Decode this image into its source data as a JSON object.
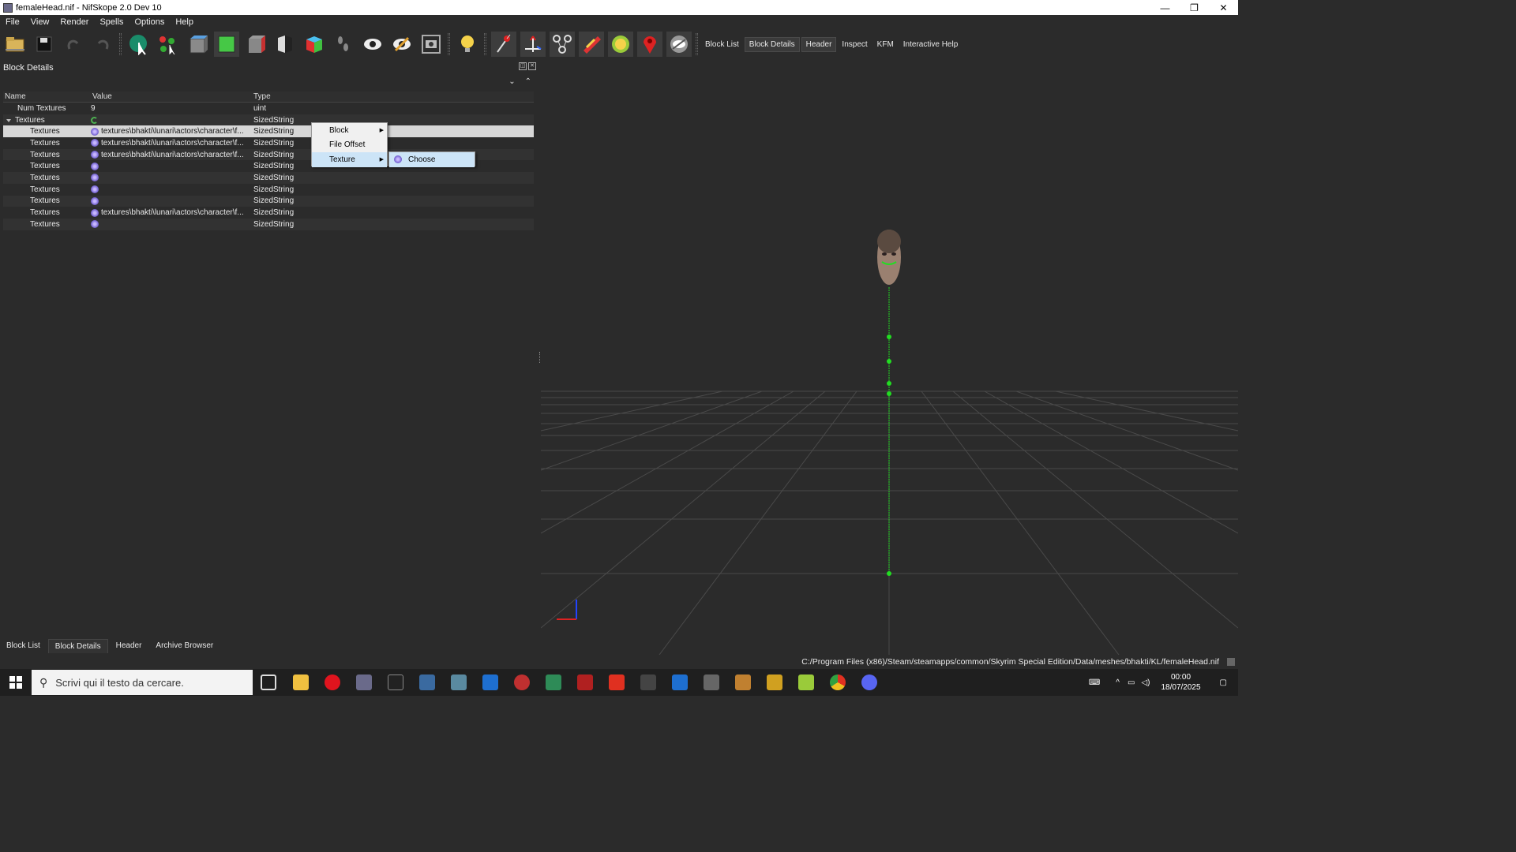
{
  "window": {
    "title": "femaleHead.nif - NifSkope 2.0 Dev 10",
    "buttons": [
      "—",
      "❐",
      "✕"
    ]
  },
  "menubar": {
    "items": [
      "File",
      "View",
      "Render",
      "Spells",
      "Options",
      "Help"
    ]
  },
  "toolbar": {
    "tabs": [
      "Block List",
      "Block Details",
      "Header",
      "Inspect",
      "KFM",
      "Interactive Help"
    ],
    "active_tab": "Block Details"
  },
  "block_details": {
    "title": "Block Details",
    "columns": {
      "name": "Name",
      "value": "Value",
      "type": "Type"
    },
    "rows": [
      {
        "name": "Num Textures",
        "value": "9",
        "type": "uint"
      },
      {
        "name": "Textures",
        "value": "",
        "type": "SizedString"
      },
      {
        "name": "Textures",
        "value": "textures\\bhakti\\lunari\\actors\\character\\f...",
        "type": "SizedString"
      },
      {
        "name": "Textures",
        "value": "textures\\bhakti\\lunari\\actors\\character\\f...",
        "type": "SizedString"
      },
      {
        "name": "Textures",
        "value": "textures\\bhakti\\lunari\\actors\\character\\f...",
        "type": "SizedString"
      },
      {
        "name": "Textures",
        "value": "",
        "type": "SizedString"
      },
      {
        "name": "Textures",
        "value": "",
        "type": "SizedString"
      },
      {
        "name": "Textures",
        "value": "",
        "type": "SizedString"
      },
      {
        "name": "Textures",
        "value": "",
        "type": "SizedString"
      },
      {
        "name": "Textures",
        "value": "textures\\bhakti\\lunari\\actors\\character\\f...",
        "type": "SizedString"
      },
      {
        "name": "Textures",
        "value": "",
        "type": "SizedString"
      }
    ]
  },
  "context_menu": {
    "items": [
      "Block",
      "File Offset",
      "Texture"
    ],
    "submenu": [
      "Choose"
    ]
  },
  "bottom_tabs": [
    "Block List",
    "Block Details",
    "Header",
    "Archive Browser"
  ],
  "status": {
    "path": "C:/Program Files (x86)/Steam/steamapps/common/Skyrim Special Edition/Data/meshes/bhakti/KL/femaleHead.nif"
  },
  "taskbar": {
    "search_placeholder": "Scrivi qui il testo da cercare.",
    "time": "00:00",
    "date": "18/07/2025"
  },
  "colors": {
    "grid": "#4a4a4a",
    "bone_node": "#22dd22",
    "axis_x": "#dd2222",
    "axis_z": "#2244ff"
  }
}
